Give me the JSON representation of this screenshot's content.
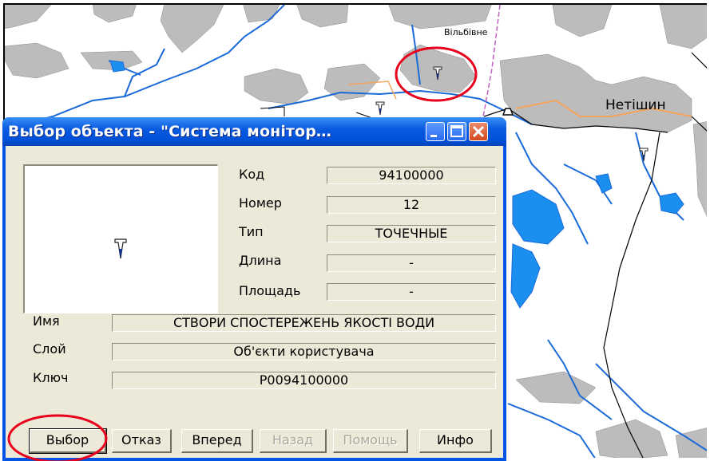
{
  "map": {
    "labels": {
      "village": "Вільбівне",
      "town": "Нетішин"
    },
    "colors": {
      "landuse": "#bcbcbc",
      "water": "#1a8ff0",
      "boundary_orange": "#f4a45a",
      "highlight": "#e8001c"
    },
    "marker_icon": "monitoring-point-icon"
  },
  "dialog": {
    "title": "Выбор объекта - \"Система монітор…",
    "window_buttons": [
      "minimize-icon",
      "maximize-icon",
      "close-icon"
    ],
    "fields": {
      "code": {
        "label": "Код",
        "value": "94100000"
      },
      "number": {
        "label": "Номер",
        "value": "12"
      },
      "type": {
        "label": "Тип",
        "value": "ТОЧЕЧНЫЕ"
      },
      "length": {
        "label": "Длина",
        "value": "-"
      },
      "area": {
        "label": "Площадь",
        "value": "-"
      },
      "name": {
        "label": "Имя",
        "value": "СТВОРИ СПОСТЕРЕЖЕНЬ ЯКОСТІ ВОДИ"
      },
      "layer": {
        "label": "Слой",
        "value": "Об'єкти користувача"
      },
      "key": {
        "label": "Ключ",
        "value": "P0094100000"
      }
    },
    "buttons": {
      "select": "Выбор",
      "cancel": "Отказ",
      "forward": "Вперед",
      "back": "Назад",
      "help": "Помощь",
      "info": "Инфо"
    }
  }
}
